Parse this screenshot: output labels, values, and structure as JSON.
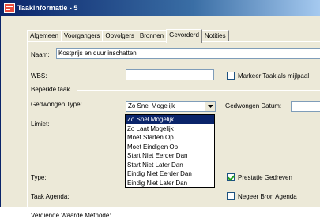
{
  "window": {
    "title": "Taakinformatie - 5"
  },
  "tabs": [
    {
      "label": "Algemeen"
    },
    {
      "label": "Voorgangers"
    },
    {
      "label": "Opvolgers"
    },
    {
      "label": "Bronnen"
    },
    {
      "label": "Gevorderd",
      "active": true
    },
    {
      "label": "Notities"
    }
  ],
  "form": {
    "name_label": "Naam:",
    "name_value": "Kostprijs en duur inschatten",
    "wbs_label": "WBS:",
    "wbs_value": "",
    "milestone_label": "Markeer Taak als mijlpaal",
    "constraint_group": "Beperkte taak",
    "constraint_type_label": "Gedwongen Type:",
    "constraint_type_value": "Zo Snel Mogelijk",
    "constraint_date_label": "Gedwongen Datum:",
    "deadline_label": "Limiet:",
    "type_label": "Type:",
    "effort_driven_label": "Prestatie Gedreven",
    "effort_driven_checked": true,
    "calendar_label": "Taak Agenda:",
    "ignore_calendar_label": "Negeer Bron Agenda",
    "earned_value_label": "Verdiende Waarde Methode:"
  },
  "dropdown": {
    "options": [
      "Zo Snel Mogelijk",
      "Zo Laat Mogelijk",
      "Moet Starten Op",
      "Moet Eindigen Op",
      "Start Niet Eerder Dan",
      "Start Niet Later Dan",
      "Eindig Niet Eerder Dan",
      "Eindig Niet Later Dan"
    ],
    "selected_index": 0
  }
}
